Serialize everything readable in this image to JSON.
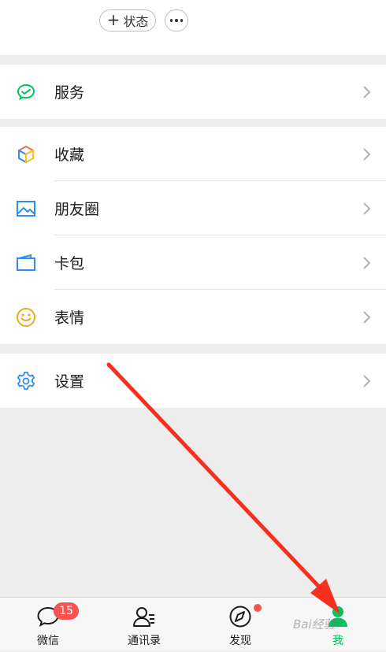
{
  "profile": {
    "status_label": "状态",
    "status_plus": "+"
  },
  "menu": {
    "services": {
      "label": "服务",
      "icon": "wechat-pay-icon"
    },
    "favorites": {
      "label": "收藏",
      "icon": "cube-icon"
    },
    "moments": {
      "label": "朋友圈",
      "icon": "picture-icon"
    },
    "card": {
      "label": "卡包",
      "icon": "wallet-card-icon"
    },
    "stickers": {
      "label": "表情",
      "icon": "smiley-icon"
    },
    "settings": {
      "label": "设置",
      "icon": "gear-icon"
    }
  },
  "tabbar": {
    "chats": {
      "label": "微信",
      "badge": "15"
    },
    "contacts": {
      "label": "通讯录"
    },
    "discover": {
      "label": "发现"
    },
    "me": {
      "label": "我"
    }
  },
  "watermark": "Bai经验",
  "colors": {
    "accent": "#07c160",
    "badge": "#fa5151",
    "arrow": "#f5301e"
  }
}
